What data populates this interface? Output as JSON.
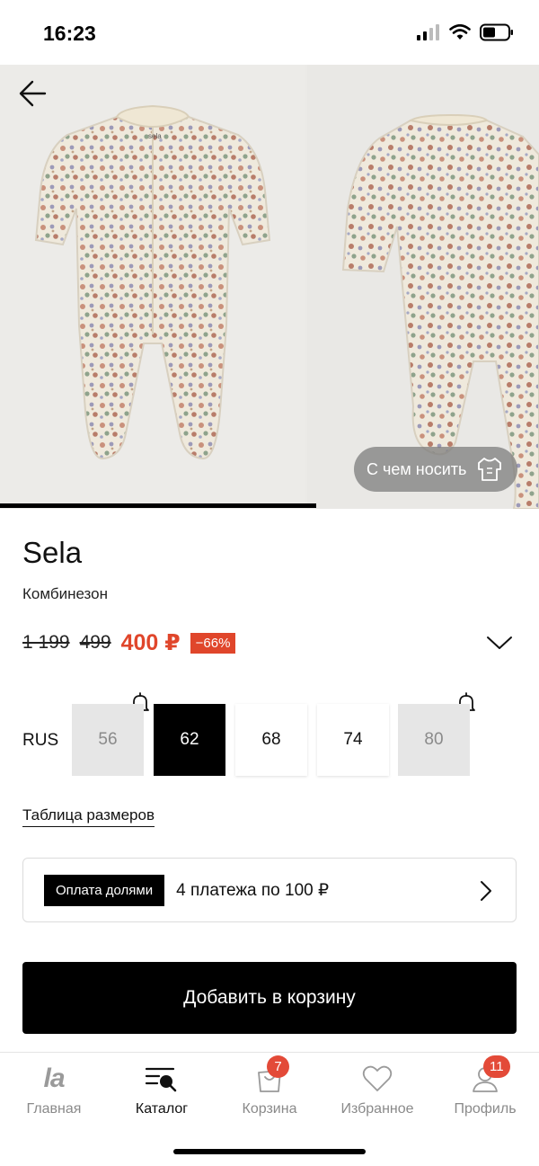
{
  "status_bar": {
    "time": "16:23"
  },
  "gallery": {
    "outfit_button": "С чем носить",
    "label_tag": "sela"
  },
  "product": {
    "brand": "Sela",
    "type": "Комбинезон",
    "old_price": "1 199",
    "mid_price": "499",
    "price": "400 ₽",
    "discount": "−66%"
  },
  "sizes": {
    "label": "RUS",
    "options": [
      {
        "value": "56",
        "state": "unavailable",
        "notify": true
      },
      {
        "value": "62",
        "state": "selected",
        "notify": false
      },
      {
        "value": "68",
        "state": "available",
        "notify": false
      },
      {
        "value": "74",
        "state": "available",
        "notify": false
      },
      {
        "value": "80",
        "state": "unavailable",
        "notify": true
      }
    ],
    "table_link": "Таблица размеров"
  },
  "installment": {
    "badge": "Оплата долями",
    "text": "4 платежа по 100 ₽"
  },
  "cart_button": "Добавить в корзину",
  "tabbar": {
    "items": [
      {
        "label": "Главная",
        "icon": "la-logo-icon"
      },
      {
        "label": "Каталог",
        "icon": "catalog-search-icon",
        "active": true
      },
      {
        "label": "Корзина",
        "icon": "shopping-bag-icon",
        "badge": "7"
      },
      {
        "label": "Избранное",
        "icon": "heart-icon"
      },
      {
        "label": "Профиль",
        "icon": "profile-icon",
        "badge": "11"
      }
    ]
  },
  "colors": {
    "accent": "#e0462b",
    "badge": "#e34a38",
    "primary": "#000000"
  }
}
